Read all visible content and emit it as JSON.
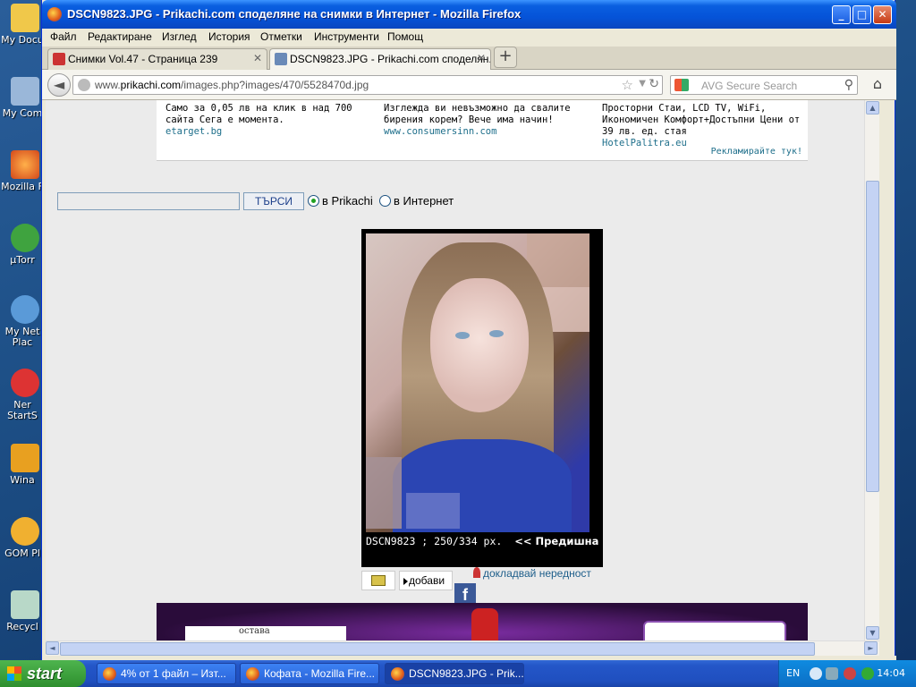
{
  "desktop": {
    "icons": [
      {
        "label": "My Docu"
      },
      {
        "label": "My Com"
      },
      {
        "label": "Mozilla F"
      },
      {
        "label": "µTorr"
      },
      {
        "label": "My Net\nPlac"
      },
      {
        "label": "Ner\nStartS"
      },
      {
        "label": "Wina"
      },
      {
        "label": "GOM Pl"
      },
      {
        "label": "Recycl"
      }
    ]
  },
  "window": {
    "title": "DSCN9823.JPG - Prikachi.com споделяне на снимки в Интернет - Mozilla Firefox",
    "controls": {
      "minimize": "_",
      "maximize": "□",
      "close": "✕"
    }
  },
  "menubar": [
    "Файл",
    "Редактиране",
    "Изглед",
    "История",
    "Отметки",
    "Инструменти",
    "Помощ"
  ],
  "tabs": [
    {
      "label": "Снимки Vol.47 - Страница 239",
      "active": false
    },
    {
      "label": "DSCN9823.JPG - Prikachi.com споделян...",
      "active": true
    }
  ],
  "newtab": "+",
  "navbar": {
    "url_prefix": "www.",
    "url_domain": "prikachi.com",
    "url_path": "/images.php?images/470/5528470d.jpg",
    "search_placeholder": "AVG Secure Search"
  },
  "ads_top": [
    {
      "text": "Само за 0,05 лв на клик в над 700 сайта Сега е момента.",
      "link": "etarget.bg"
    },
    {
      "text": "Изглежда ви невъзможно да свалите бирения корем? Вече има начин!",
      "link": "www.consumersinn.com"
    },
    {
      "text": "Просторни Стаи, LCD TV, WiFi, Икономичен Комфорт+Достъпни Цени от 39 лв. ед. стая",
      "link": "HotelPalitra.eu"
    }
  ],
  "ad_report": "Рекламирайте тук!",
  "site_search": {
    "button": "ТЪРСИ",
    "option_prikachi": "в Prikachi",
    "option_internet": "в Интернет"
  },
  "image": {
    "caption": "DSCN9823 ; 250/334 px.",
    "prev": "<< Предишна"
  },
  "actions": {
    "add": "добави",
    "report": "докладвай нередност",
    "facebook": "f"
  },
  "ad_bottom": {
    "card_text": "остава"
  },
  "taskbar": {
    "start": "start",
    "tasks": [
      {
        "label": "4% от 1 файл – Изт...",
        "active": false
      },
      {
        "label": "Кофата - Mozilla Fire...",
        "active": false
      },
      {
        "label": "DSCN9823.JPG - Prik...",
        "active": true
      }
    ],
    "lang": "EN",
    "clock": "14:04"
  }
}
